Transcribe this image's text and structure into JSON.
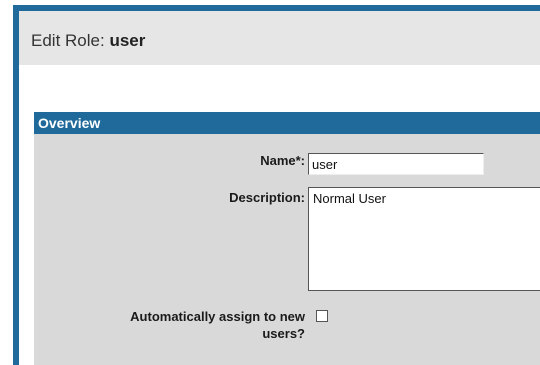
{
  "page": {
    "title_prefix": "Edit Role:",
    "role_name": "user"
  },
  "overview": {
    "header": "Overview",
    "name_label": "Name*:",
    "name_value": "user",
    "description_label": "Description:",
    "description_value": "Normal User",
    "auto_assign_label": "Automatically assign to new users?",
    "auto_assign_checked": false
  },
  "colors": {
    "accent": "#1f6a9a",
    "title_bar_bg": "#e6e6e6",
    "section_bg": "#d9d9d9"
  }
}
